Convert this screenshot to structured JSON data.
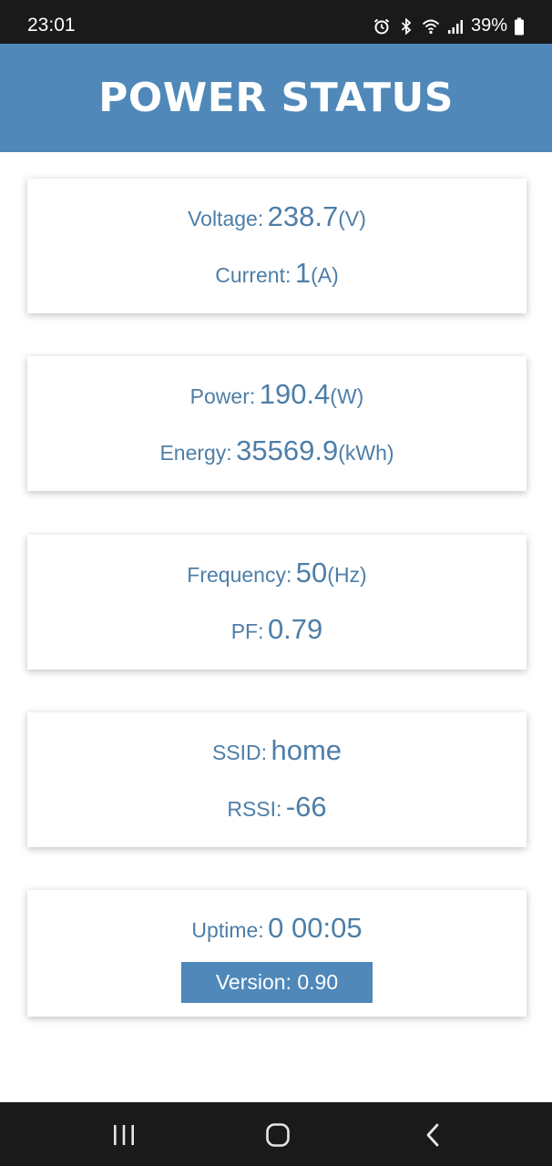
{
  "status_bar": {
    "time": "23:01",
    "battery": "39%"
  },
  "header": {
    "title": "POWER STATUS"
  },
  "cards": {
    "voltage": {
      "label": "Voltage:",
      "value": "238.7",
      "unit": "(V)"
    },
    "current": {
      "label": "Current:",
      "value": "1",
      "unit": "(A)"
    },
    "power": {
      "label": "Power:",
      "value": "190.4",
      "unit": "(W)"
    },
    "energy": {
      "label": "Energy:",
      "value": "35569.9",
      "unit": "(kWh)"
    },
    "frequency": {
      "label": "Frequency:",
      "value": "50",
      "unit": "(Hz)"
    },
    "pf": {
      "label": "PF:",
      "value": "0.79"
    },
    "ssid": {
      "label": "SSID:",
      "value": "home"
    },
    "rssi": {
      "label": "RSSI:",
      "value": "-66"
    },
    "uptime": {
      "label": "Uptime:",
      "value": "0 00:05"
    },
    "version": "Version: 0.90"
  },
  "colors": {
    "header_bg": "#4f88b9",
    "text": "#4d7ea8",
    "system_bar": "#1a1a1a"
  },
  "icons": {
    "status": [
      "alarm-icon",
      "bluetooth-icon",
      "wifi-icon",
      "signal-icon",
      "battery-icon"
    ],
    "nav": [
      "recent-apps-icon",
      "home-icon",
      "back-icon"
    ]
  }
}
